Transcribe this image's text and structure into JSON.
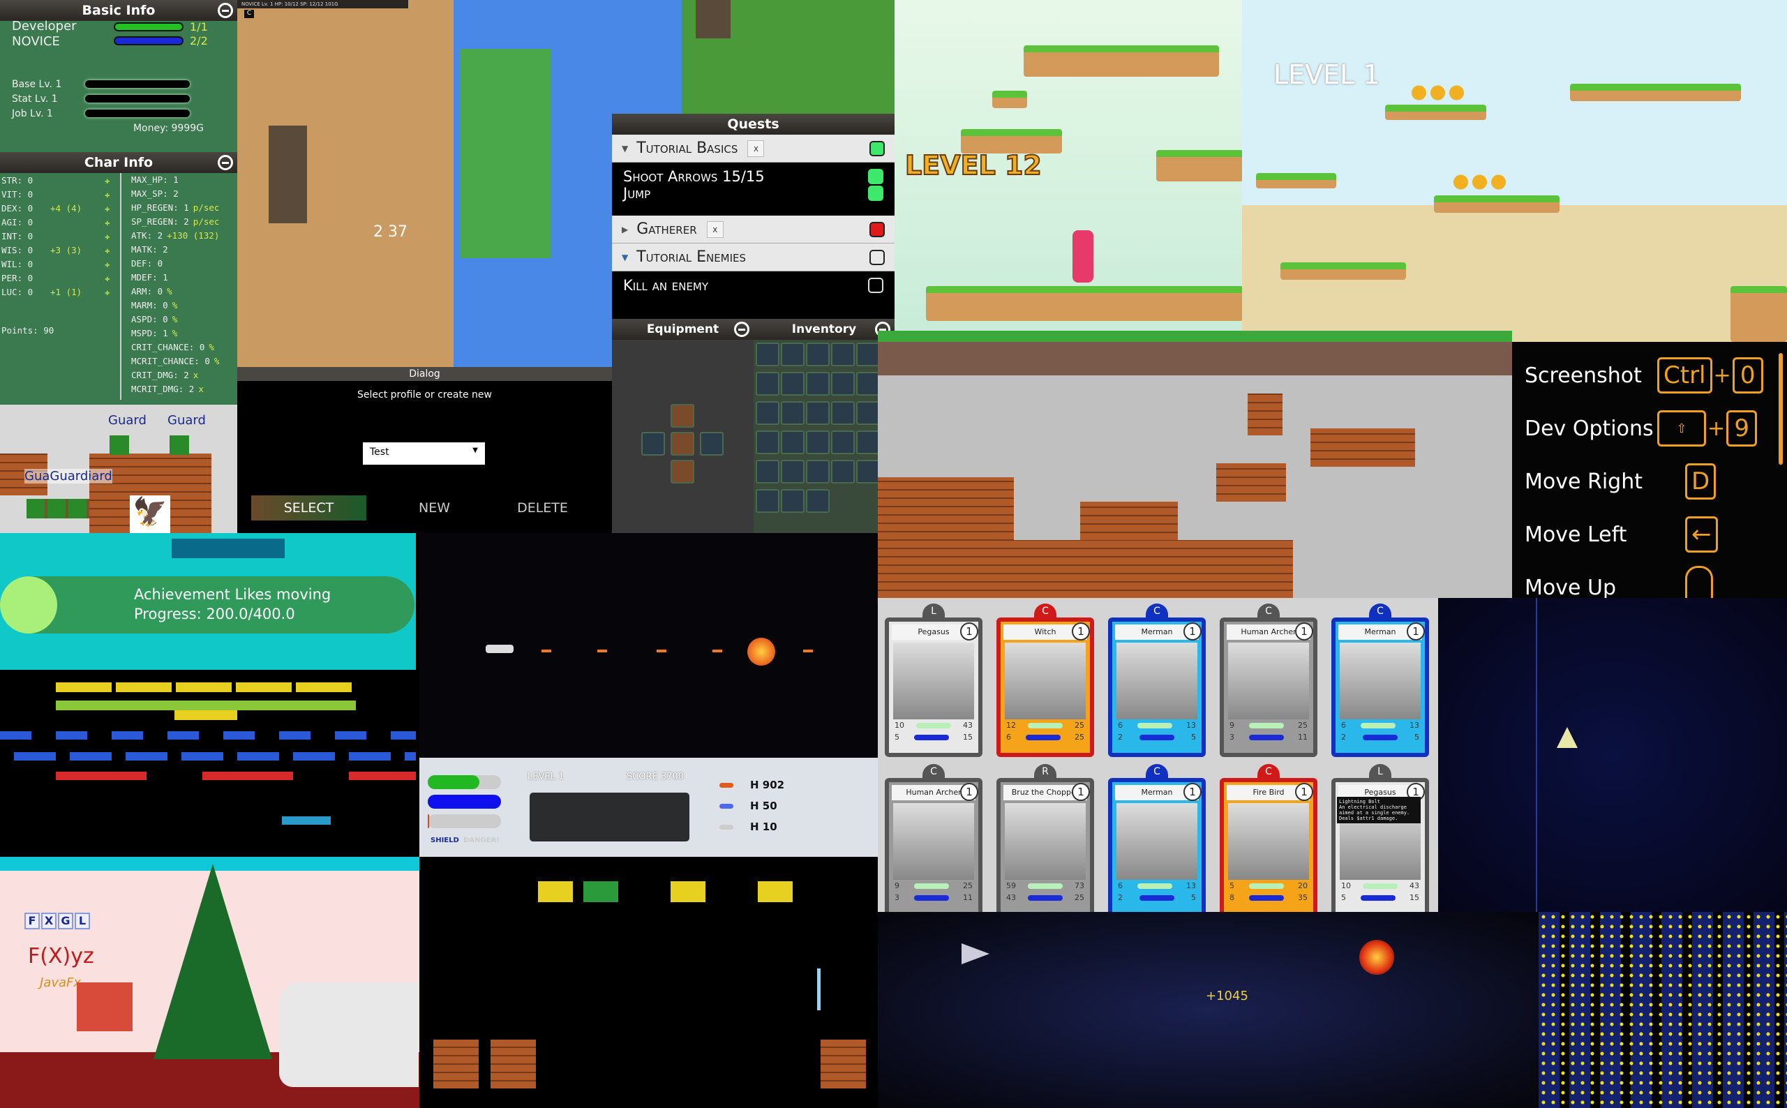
{
  "basic_info": {
    "title": "Basic Info",
    "name": "Developer",
    "class": "NOVICE",
    "hp": "1/1",
    "sp": "2/2",
    "hp_fill": 1.0,
    "sp_fill": 1.0,
    "levels": [
      "Base Lv. 1",
      "Stat Lv. 1",
      "Job Lv. 1"
    ],
    "money": "Money: 9999G"
  },
  "char_info": {
    "title": "Char Info",
    "stats": [
      {
        "k": "STR: 0",
        "b": ""
      },
      {
        "k": "VIT: 0",
        "b": ""
      },
      {
        "k": "DEX: 0",
        "b": "+4 (4)"
      },
      {
        "k": "AGI: 0",
        "b": ""
      },
      {
        "k": "INT: 0",
        "b": ""
      },
      {
        "k": "WIS: 0",
        "b": "+3 (3)"
      },
      {
        "k": "WIL: 0",
        "b": ""
      },
      {
        "k": "PER: 0",
        "b": ""
      },
      {
        "k": "LUC: 0",
        "b": "+1 (1)"
      }
    ],
    "points": "Points: 90",
    "attrs": [
      {
        "k": "MAX_HP: 1",
        "u": ""
      },
      {
        "k": "MAX_SP: 2",
        "u": ""
      },
      {
        "k": "HP_REGEN: 1",
        "u": "p/sec"
      },
      {
        "k": "SP_REGEN: 2",
        "u": "p/sec"
      },
      {
        "k": "ATK: 2",
        "u": "+130 (132)"
      },
      {
        "k": "MATK: 2",
        "u": ""
      },
      {
        "k": "DEF: 0",
        "u": ""
      },
      {
        "k": "MDEF: 1",
        "u": ""
      },
      {
        "k": "ARM: 0",
        "u": "%"
      },
      {
        "k": "MARM: 0",
        "u": "%"
      },
      {
        "k": "ASPD: 0",
        "u": "%"
      },
      {
        "k": "MSPD: 1",
        "u": "%"
      },
      {
        "k": "CRIT_CHANCE: 0",
        "u": "%"
      },
      {
        "k": "MCRIT_CHANCE: 0",
        "u": "%"
      },
      {
        "k": "CRIT_DMG: 2",
        "u": "x"
      },
      {
        "k": "MCRIT_DMG: 2",
        "u": "x"
      }
    ]
  },
  "rpg_hud": {
    "status": "NOVICE   Lv. 1   HP: 10/12   SP: 12/12   101G",
    "key": "C",
    "damage": "2  37"
  },
  "dialog": {
    "title": "Dialog",
    "prompt": "Select profile or create new",
    "profile": "Test",
    "select": "SELECT",
    "new": "NEW",
    "delete": "DELETE"
  },
  "quests": {
    "title": "Quests",
    "groups": [
      {
        "name": "Tutorial Basics",
        "x": "x",
        "status": "#3ee86a",
        "expanded": true,
        "tasks": [
          {
            "t": "Shoot Arrows  15/15",
            "s": "#3ee86a"
          },
          {
            "t": "Jump",
            "s": "#3ee86a"
          }
        ]
      },
      {
        "name": "Gatherer",
        "x": "x",
        "status": "#e01b1b",
        "expanded": false,
        "tasks": []
      },
      {
        "name": "Tutorial Enemies",
        "status": "none",
        "expanded": true,
        "tasks": [
          {
            "t": "Kill an enemy",
            "s": "none"
          }
        ]
      }
    ]
  },
  "equipment": {
    "title": "Equipment"
  },
  "inventory": {
    "title": "Inventory"
  },
  "tanks": {
    "labels": [
      "Guard",
      "Guard",
      "GuaGuardiard"
    ]
  },
  "platformer1": {
    "level": "LEVEL 12"
  },
  "platformer2": {
    "level": "LEVEL 1"
  },
  "controls": [
    {
      "action": "Screenshot",
      "keys": [
        "Ctrl",
        "0"
      ]
    },
    {
      "action": "Dev Options",
      "keys": [
        "⇧",
        "9"
      ]
    },
    {
      "action": "Move Right",
      "keys": [
        "D"
      ]
    },
    {
      "action": "Move Left",
      "keys": [
        "←"
      ]
    },
    {
      "action": "Move Up",
      "keys": [
        "mouse"
      ]
    }
  ],
  "achievement": {
    "title": "Achievement Likes moving",
    "progress": "Progress: 200.0/400.0",
    "fraction": 0.5
  },
  "shooter_hud": {
    "level": "LEVEL 1",
    "score": "SCORE 3700",
    "ammo": [
      "H 902",
      "H 50",
      "H 10"
    ],
    "shield": "SHIELD",
    "danger": "DANGER!",
    "health_fill": 0.7,
    "shield_fill": 1.0,
    "danger_fill": 0.02
  },
  "cards": [
    {
      "rarity": "L",
      "name": "Pegasus",
      "level": "1",
      "atk": "10",
      "def": "5",
      "hp": "43",
      "mp": "15",
      "color": "#e8e8e8",
      "frame": "#555"
    },
    {
      "rarity": "C",
      "name": "Witch",
      "level": "1",
      "atk": "12",
      "def": "6",
      "hp": "25",
      "mp": "25",
      "color": "#f5a41a",
      "frame": "#d01a1a"
    },
    {
      "rarity": "C",
      "name": "Merman",
      "level": "1",
      "atk": "6",
      "def": "2",
      "hp": "13",
      "mp": "5",
      "color": "#2ab8ea",
      "frame": "#1030c0"
    },
    {
      "rarity": "C",
      "name": "Human Archer",
      "level": "1",
      "atk": "9",
      "def": "3",
      "hp": "25",
      "mp": "11",
      "color": "#9a9a9a",
      "frame": "#555"
    },
    {
      "rarity": "C",
      "name": "Merman",
      "level": "1",
      "atk": "6",
      "def": "2",
      "hp": "13",
      "mp": "5",
      "color": "#2ab8ea",
      "frame": "#1030c0"
    },
    {
      "rarity": "C",
      "name": "Human Archer",
      "level": "1",
      "atk": "9",
      "def": "3",
      "hp": "25",
      "mp": "11",
      "color": "#9a9a9a",
      "frame": "#555"
    },
    {
      "rarity": "R",
      "name": "Bruz the Chopper",
      "level": "1",
      "atk": "59",
      "def": "43",
      "hp": "73",
      "mp": "25",
      "color": "#9a9a9a",
      "frame": "#555"
    },
    {
      "rarity": "C",
      "name": "Merman",
      "level": "1",
      "atk": "6",
      "def": "2",
      "hp": "13",
      "mp": "5",
      "color": "#2ab8ea",
      "frame": "#1030c0"
    },
    {
      "rarity": "C",
      "name": "Fire Bird",
      "level": "1",
      "atk": "5",
      "def": "8",
      "hp": "20",
      "mp": "35",
      "color": "#f5a41a",
      "frame": "#d01a1a"
    },
    {
      "rarity": "L",
      "name": "Pegasus",
      "level": "1",
      "atk": "10",
      "def": "5",
      "hp": "43",
      "mp": "15",
      "color": "#e8e8e8",
      "frame": "#555"
    }
  ],
  "card_tooltip": "Lightning Bolt\nAn electrical discharge aimed at a single enemy. Deals $attr1 damage.",
  "space": {
    "score_popup": "+1045"
  },
  "xmas": {
    "logo_letters": [
      "F",
      "X",
      "G",
      "L"
    ],
    "title": "F(X)yz",
    "javafx": "JavaFx"
  }
}
